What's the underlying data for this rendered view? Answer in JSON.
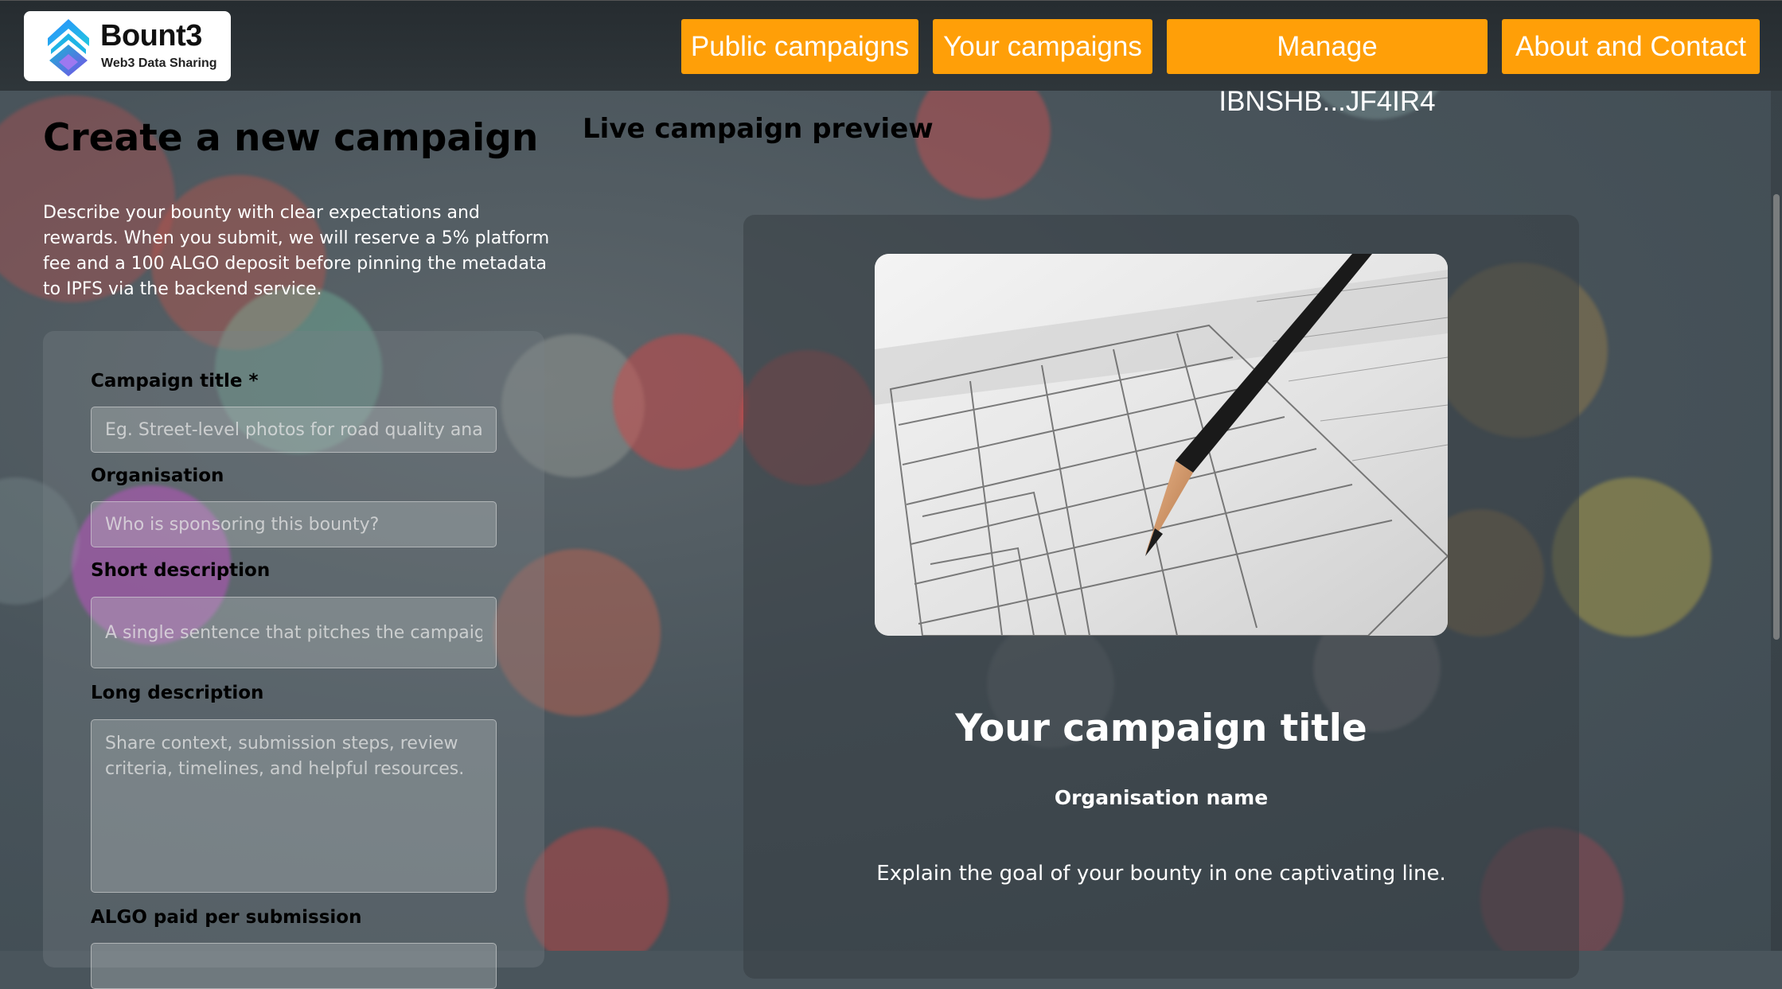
{
  "header": {
    "logo": {
      "name": "Bount3",
      "tagline": "Web3 Data Sharing"
    },
    "nav": [
      {
        "label": "Public campaigns"
      },
      {
        "label": "Your campaigns"
      },
      {
        "label": "Manage IBNSHB...JF4IR4"
      },
      {
        "label": "About and Contact"
      }
    ]
  },
  "form": {
    "title": "Create a new campaign",
    "intro": "Describe your bounty with clear expectations and rewards. When you submit, we will reserve a 5% platform fee and a 100 ALGO deposit before pinning the metadata to IPFS via the backend service.",
    "fields": {
      "campaign_title": {
        "label": "Campaign title *",
        "placeholder": "Eg. Street-level photos for road quality analysis"
      },
      "organisation": {
        "label": "Organisation",
        "placeholder": "Who is sponsoring this bounty?"
      },
      "short_description": {
        "label": "Short description",
        "placeholder": "A single sentence that pitches the campaign"
      },
      "long_description": {
        "label": "Long description",
        "placeholder": "Share context, submission steps, review criteria, timelines, and helpful resources."
      },
      "algo_per_submission": {
        "label": "ALGO paid per submission"
      }
    }
  },
  "preview": {
    "heading": "Live campaign preview",
    "title": "Your campaign title",
    "organisation": "Organisation name",
    "short": "Explain the goal of your bounty in one captivating line."
  },
  "colors": {
    "nav_bg": "#ff9f08",
    "header_bg": "#2b3135"
  }
}
